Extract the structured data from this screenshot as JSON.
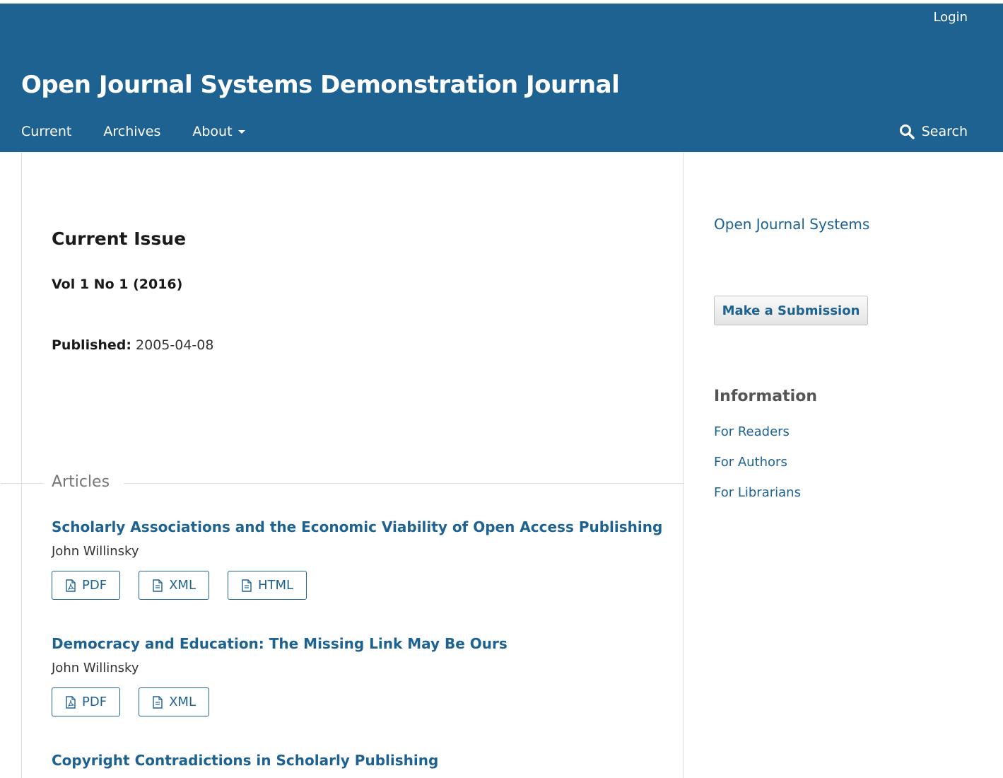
{
  "header": {
    "login_label": "Login",
    "site_title": "Open Journal Systems Demonstration Journal",
    "nav": {
      "current": "Current",
      "archives": "Archives",
      "about": "About"
    },
    "search_label": "Search",
    "colors": {
      "header_bg": "#1e6292",
      "link": "#1e6292"
    }
  },
  "main": {
    "heading": "Current Issue",
    "issue": "Vol 1 No 1 (2016)",
    "published_label": "Published:",
    "published_date": "2005-04-08",
    "articles_section_label": "Articles",
    "articles": [
      {
        "title": "Scholarly Associations and the Economic Viability of Open Access Publishing",
        "author": "John Willinsky",
        "galleys": [
          {
            "label": "PDF",
            "icon": "pdf-file-icon"
          },
          {
            "label": "XML",
            "icon": "document-icon"
          },
          {
            "label": "HTML",
            "icon": "document-icon"
          }
        ]
      },
      {
        "title": "Democracy and Education: The Missing Link May Be Ours",
        "author": "John Willinsky",
        "galleys": [
          {
            "label": "PDF",
            "icon": "pdf-file-icon"
          },
          {
            "label": "XML",
            "icon": "document-icon"
          }
        ]
      },
      {
        "title": "Copyright Contradictions in Scholarly Publishing"
      }
    ]
  },
  "sidebar": {
    "ojs_link": "Open Journal Systems",
    "submission_button": "Make a Submission",
    "information_heading": "Information",
    "info_links": [
      "For Readers",
      "For Authors",
      "For Librarians"
    ]
  }
}
